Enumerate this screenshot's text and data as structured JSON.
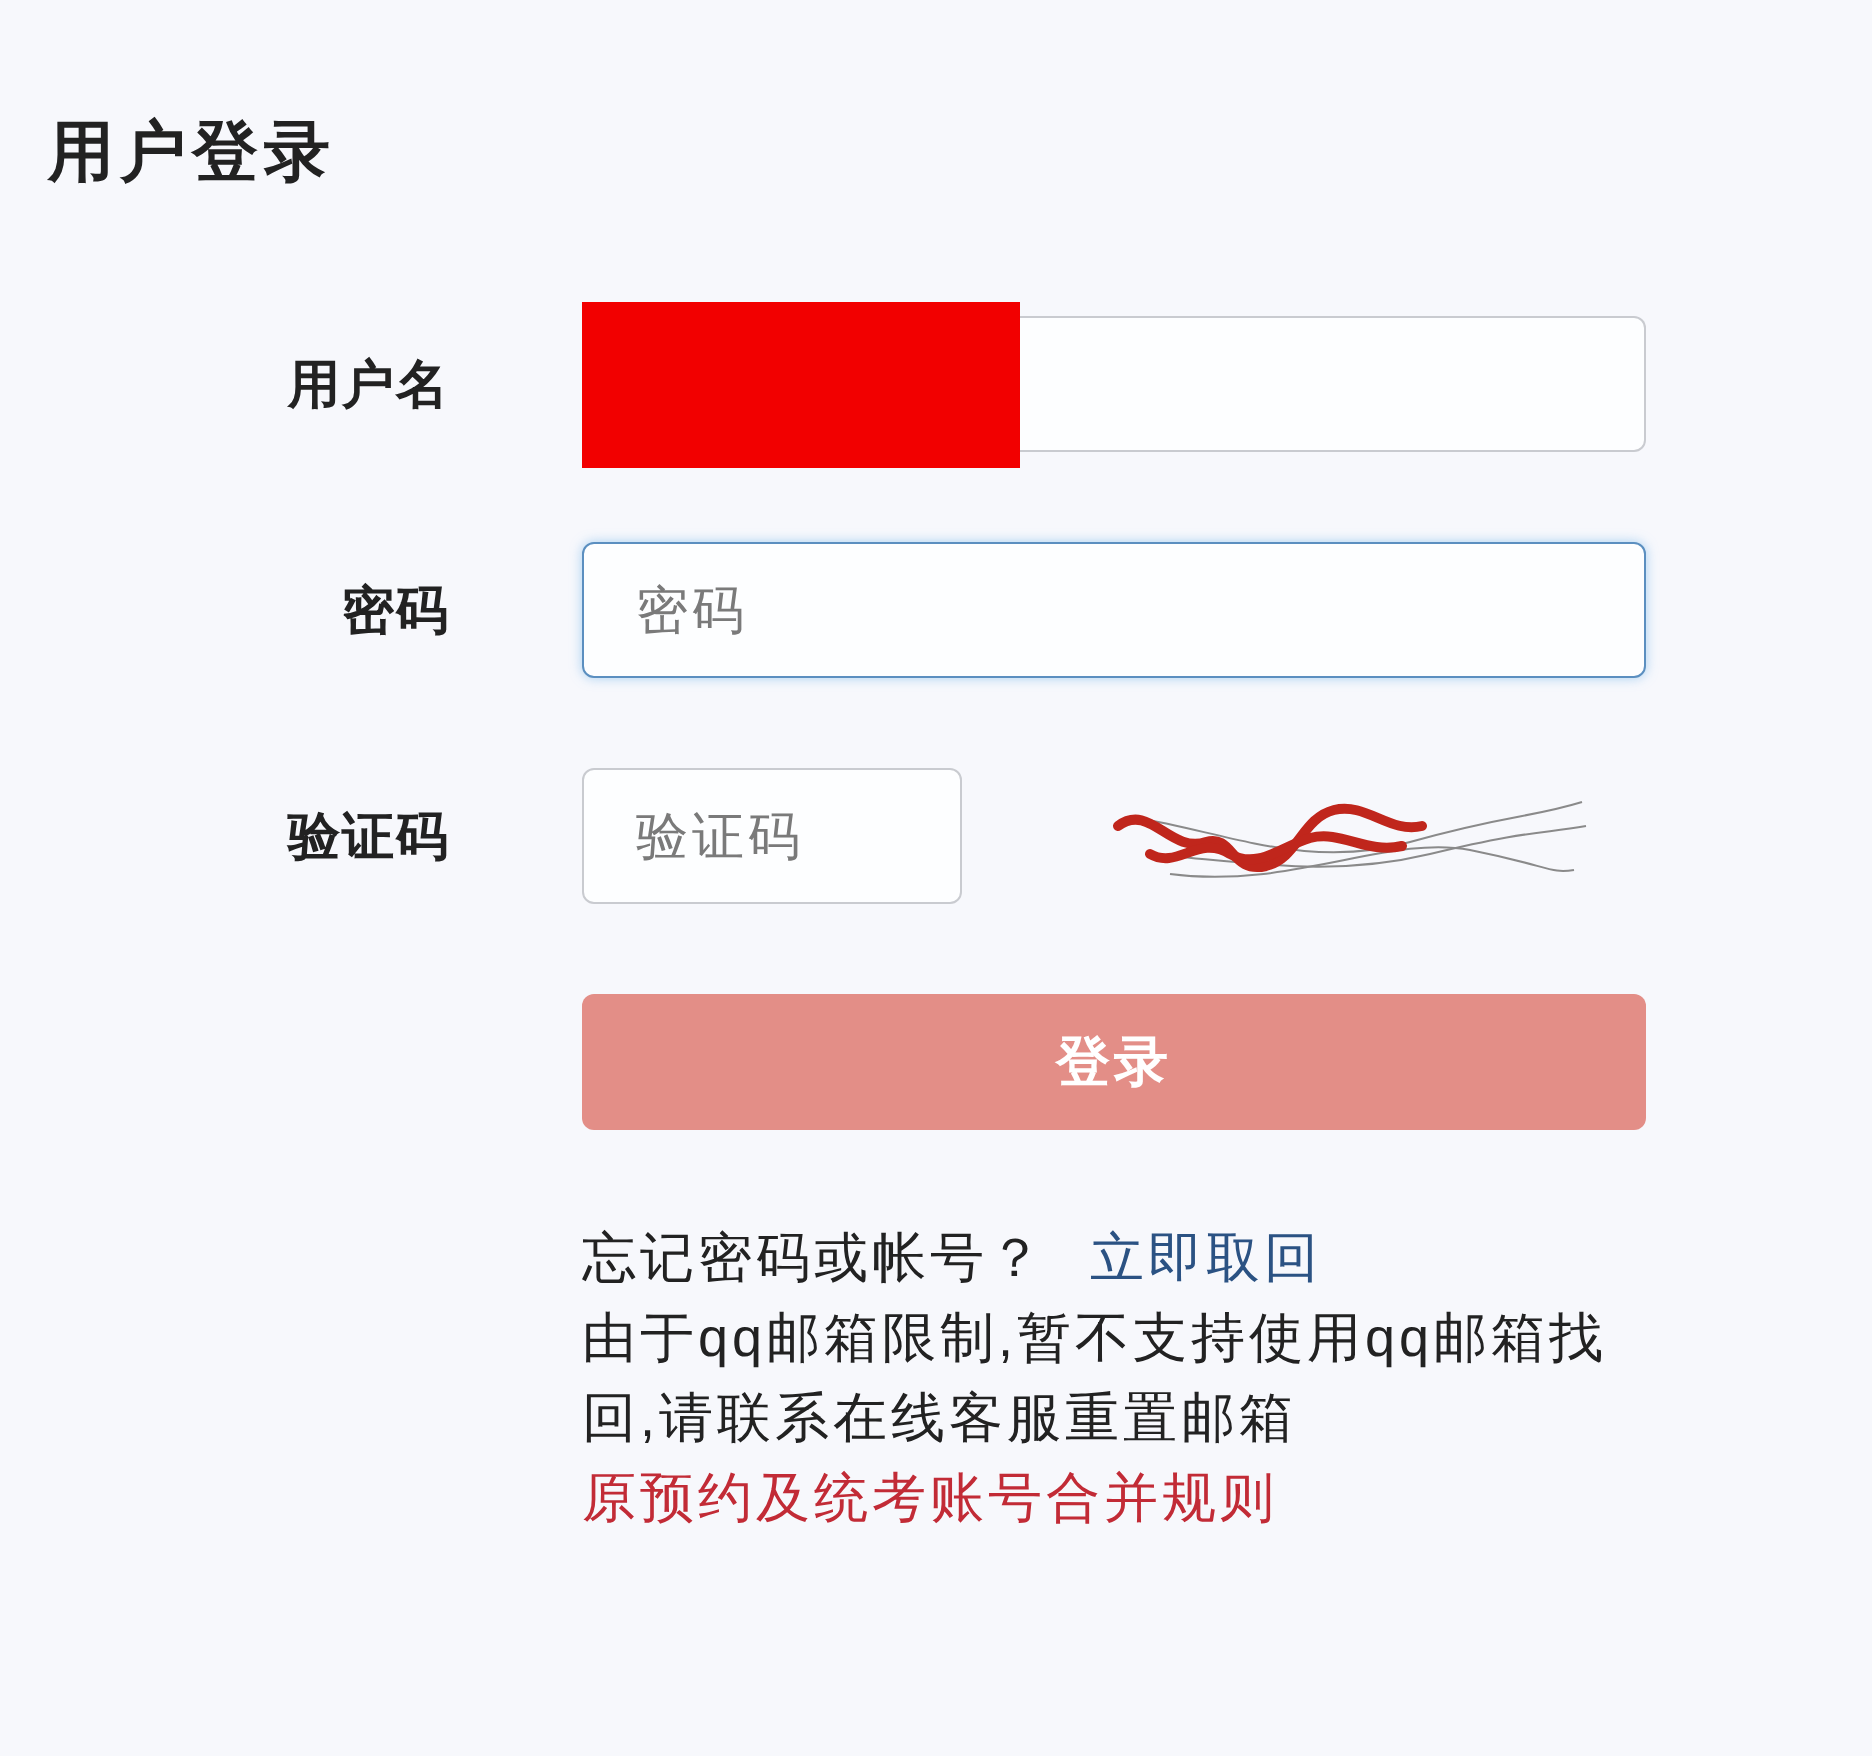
{
  "title": "用户登录",
  "form": {
    "username": {
      "label": "用户名",
      "focused": false,
      "redacted": true
    },
    "password": {
      "label": "密码",
      "placeholder": "密码",
      "focused": true
    },
    "captcha": {
      "label": "验证码",
      "placeholder": "验证码",
      "focused": false
    },
    "login_button": {
      "label": "登录",
      "disabled": true
    }
  },
  "help": {
    "question": "忘记密码或帐号？",
    "recover_link": "立即取回",
    "notice": "由于qq邮箱限制,暂不支持使用qq邮箱找回,请联系在线客服重置邮箱",
    "rules_link": "原预约及统考账号合并规则"
  }
}
